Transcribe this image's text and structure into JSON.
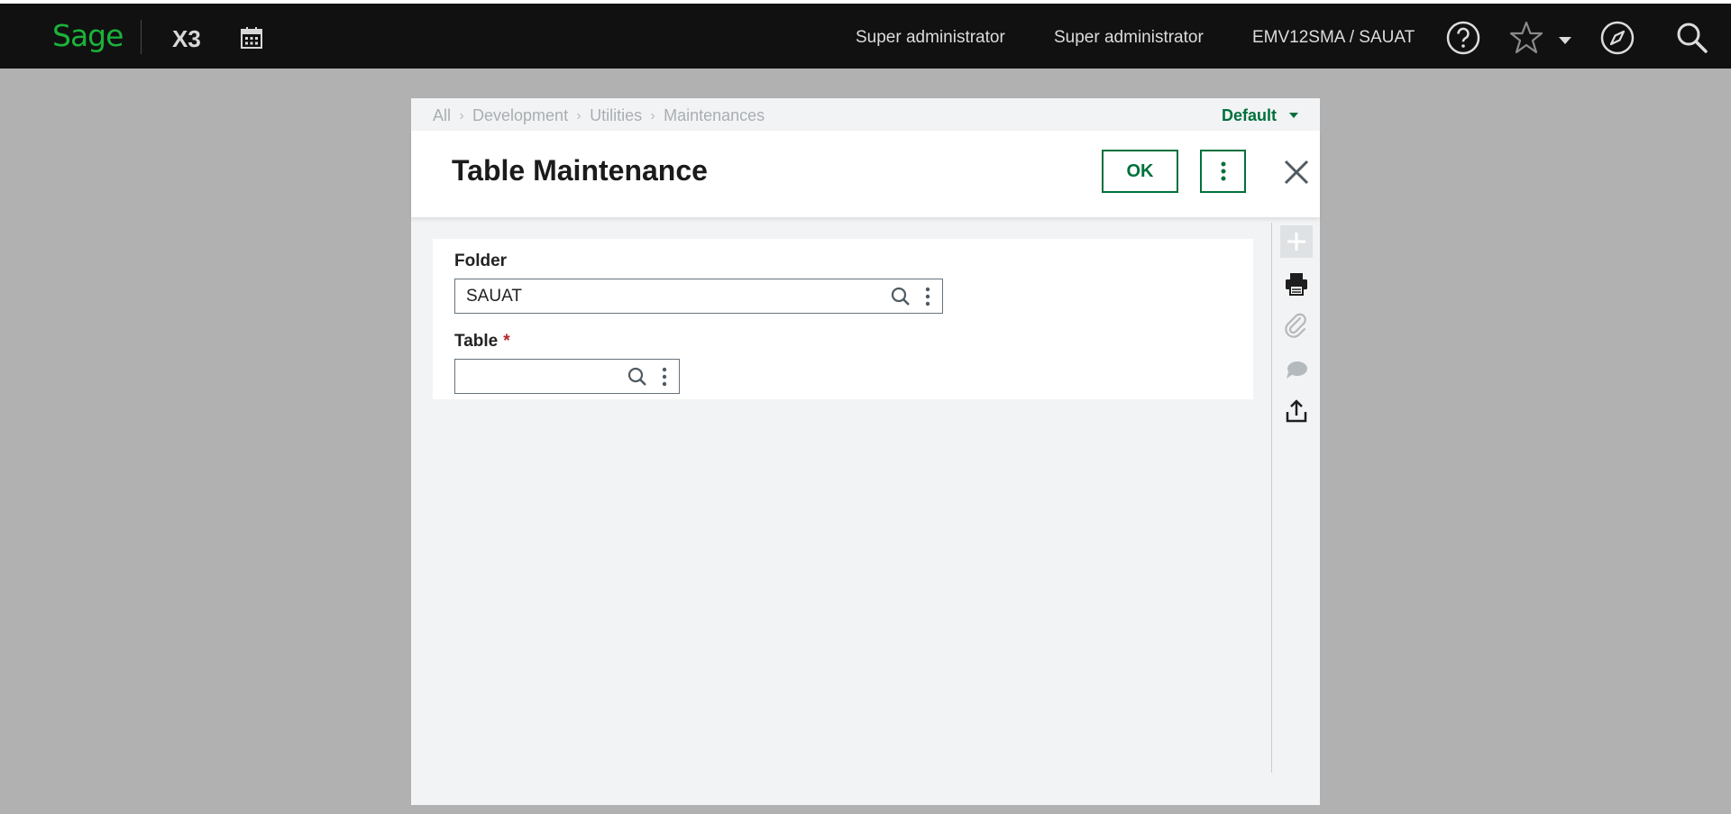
{
  "topbar": {
    "logo": "Sage",
    "app_name": "X3",
    "user_1": "Super administrator",
    "user_2": "Super administrator",
    "endpoint": "EMV12SMA / SAUAT",
    "icons": [
      "calendar-icon",
      "help-icon",
      "star-icon",
      "chevron-down-icon",
      "compass-icon",
      "search-icon"
    ]
  },
  "dialog": {
    "breadcrumb": [
      "All",
      "Development",
      "Utilities",
      "Maintenances"
    ],
    "view": "Default",
    "title": "Table Maintenance",
    "ok_label": "OK",
    "folder": {
      "label": "Folder",
      "value": "SAUAT"
    },
    "table": {
      "label": "Table",
      "required_mark": "*",
      "value": ""
    },
    "side_icons": [
      "plus-icon",
      "print-icon",
      "attachment-icon",
      "comment-icon",
      "share-icon"
    ]
  },
  "colors": {
    "brand_green": "#00703c",
    "logo_green": "#1bb33a",
    "topbar_bg": "#111111",
    "overlay_bg": "#b1b1b1"
  }
}
